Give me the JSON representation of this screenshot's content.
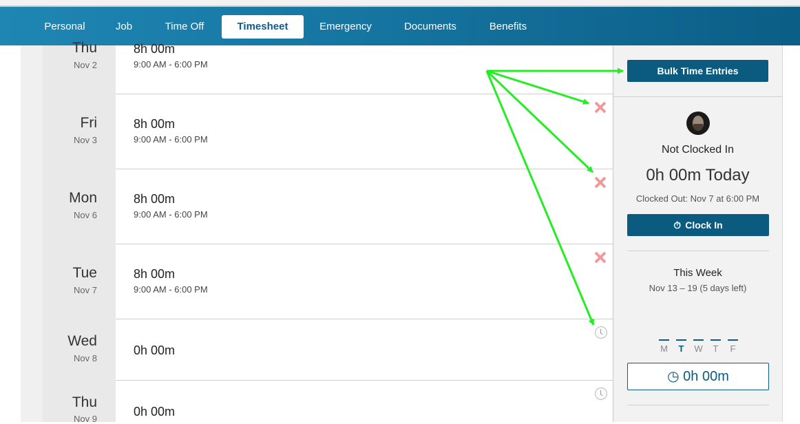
{
  "tabs": [
    {
      "label": "Personal",
      "active": false
    },
    {
      "label": "Job",
      "active": false
    },
    {
      "label": "Time Off",
      "active": false
    },
    {
      "label": "Timesheet",
      "active": true
    },
    {
      "label": "Emergency",
      "active": false
    },
    {
      "label": "Documents",
      "active": false
    },
    {
      "label": "Benefits",
      "active": false
    }
  ],
  "days": [
    {
      "day": "Thu",
      "date": "Nov 2",
      "hours": "8h 00m",
      "range": "9:00 AM - 6:00 PM",
      "action_icon": null
    },
    {
      "day": "Fri",
      "date": "Nov 3",
      "hours": "8h 00m",
      "range": "9:00 AM - 6:00 PM",
      "action_icon": "delete-x-icon"
    },
    {
      "day": "Mon",
      "date": "Nov 6",
      "hours": "8h 00m",
      "range": "9:00 AM - 6:00 PM",
      "action_icon": "delete-x-icon"
    },
    {
      "day": "Tue",
      "date": "Nov 7",
      "hours": "8h 00m",
      "range": "9:00 AM - 6:00 PM",
      "action_icon": "delete-x-icon"
    },
    {
      "day": "Wed",
      "date": "Nov 8",
      "hours": "0h 00m",
      "range": "",
      "action_icon": "clock-icon"
    },
    {
      "day": "Thu",
      "date": "Nov 9",
      "hours": "0h 00m",
      "range": "",
      "action_icon": "clock-icon"
    }
  ],
  "sidebar": {
    "bulk_button": "Bulk Time Entries",
    "status": "Not Clocked In",
    "today_total": "0h 00m Today",
    "clocked_out": "Clocked Out: Nov 7 at 6:00 PM",
    "clock_in_button": "Clock In",
    "week_title": "This Week",
    "week_range": "Nov 13 – 19 (5 days left)",
    "weekdays": [
      "M",
      "T",
      "W",
      "T",
      "F"
    ],
    "today_index": 1,
    "week_total": "0h 00m"
  },
  "colors": {
    "nav_start": "#1f86b4",
    "nav_end": "#0b5e86",
    "accent": "#0b5b80",
    "delete": "#f19a9a",
    "annotation_arrow": "#22ee22"
  }
}
